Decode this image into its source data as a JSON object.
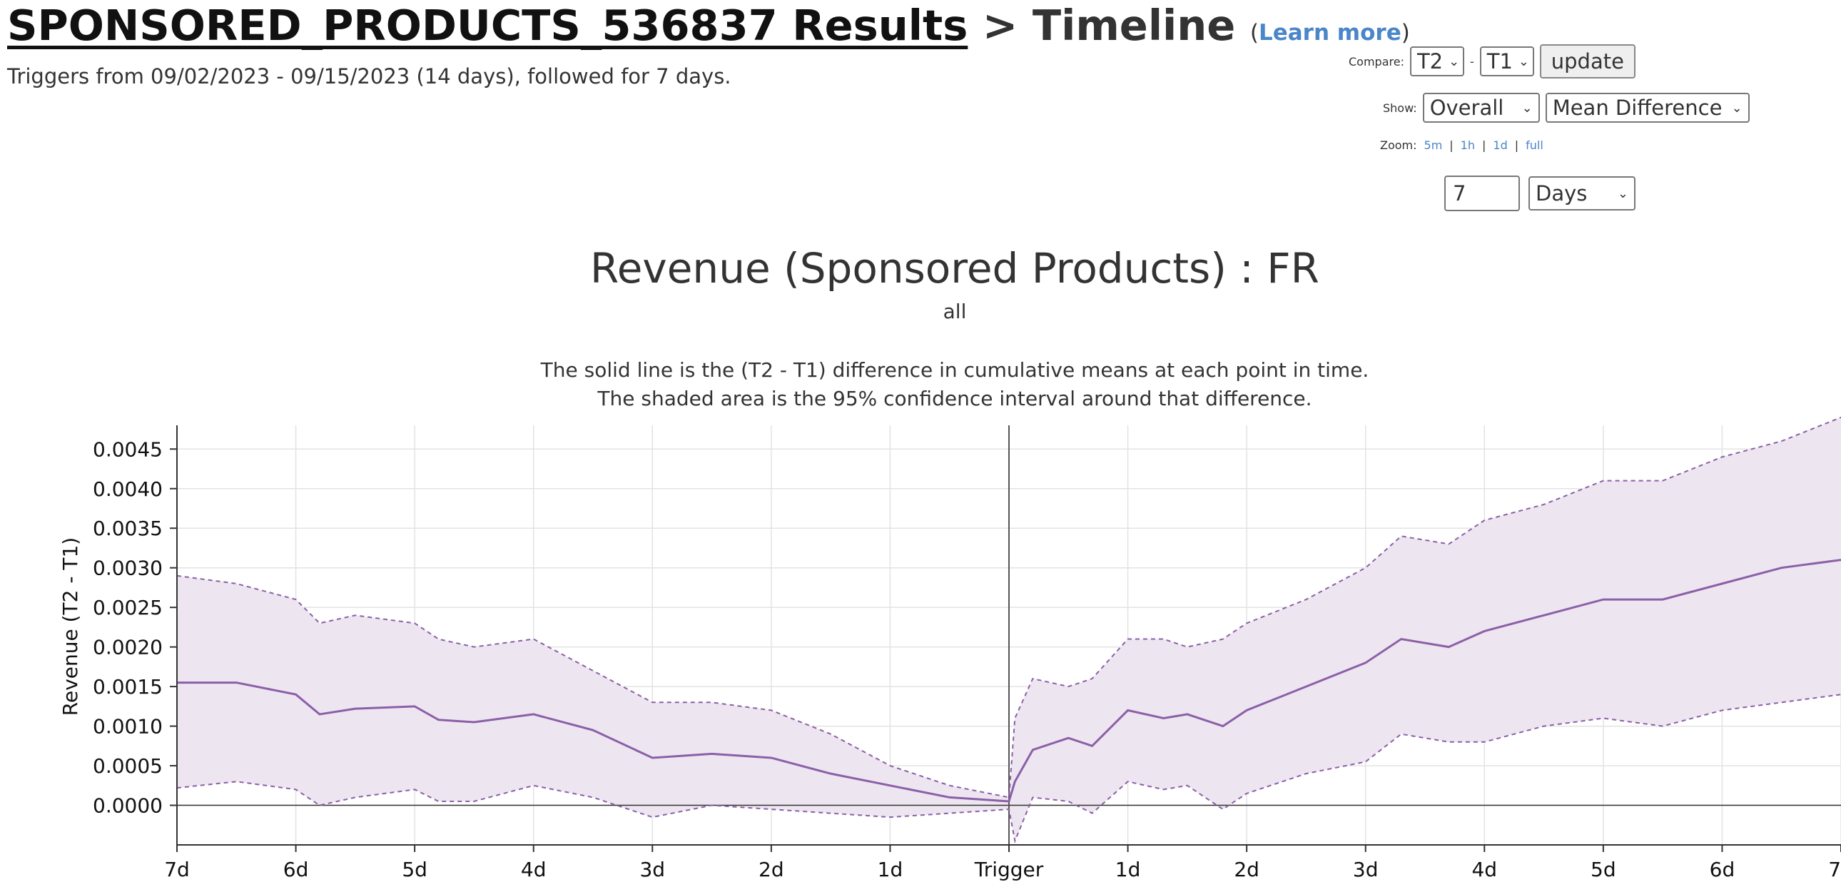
{
  "header": {
    "title_link": "SPONSORED_PRODUCTS_536837 Results",
    "title_sep": " > Timeline",
    "learn_open": "(",
    "learn_link": "Learn more",
    "learn_close": ")",
    "subtitle": "Triggers from 09/02/2023 - 09/15/2023 (14 days), followed for 7 days."
  },
  "controls": {
    "compare_label": "Compare:",
    "compare_a": "T2",
    "compare_dash": "-",
    "compare_b": "T1",
    "update_label": "update",
    "show_label": "Show:",
    "show_scope": "Overall",
    "show_metric": "Mean Difference",
    "zoom_label": "Zoom:",
    "zoom_5m": "5m",
    "zoom_1h": "1h",
    "zoom_1d": "1d",
    "zoom_full": "full",
    "zoom_sep": "|",
    "range_value": "7",
    "range_unit": "Days"
  },
  "colors": {
    "line": "#8c5fa8",
    "band_fill": "#ede6f0",
    "grid": "#e3e3e3",
    "axis": "#333333",
    "link": "#4a86c8"
  },
  "chart_data": {
    "type": "line",
    "title": "Revenue (Sponsored Products) : FR",
    "subtitle": "all",
    "description": [
      "The solid line is the (T2 - T1) difference in cumulative means at each point in time.",
      "The shaded area is the 95% confidence interval around that difference."
    ],
    "xlabel": "",
    "ylabel": "Revenue (T2 - T1)",
    "x_ticks": [
      "7d",
      "6d",
      "5d",
      "4d",
      "3d",
      "2d",
      "1d",
      "Trigger",
      "1d",
      "2d",
      "3d",
      "4d",
      "5d",
      "6d",
      "7d"
    ],
    "x_unit": "days relative to trigger",
    "xlim": [
      -7,
      7
    ],
    "ylim": [
      -0.0005,
      0.0048
    ],
    "y_ticks": [
      0.0,
      0.0005,
      0.001,
      0.0015,
      0.002,
      0.0025,
      0.003,
      0.0035,
      0.004,
      0.0045
    ],
    "grid": true,
    "series": [
      {
        "x": [
          -7,
          -6.5,
          -6,
          -5.8,
          -5.5,
          -5,
          -4.8,
          -4.5,
          -4,
          -3.5,
          -3,
          -2.5,
          -2,
          -1.5,
          -1,
          -0.5,
          0,
          0.05,
          0.2,
          0.5,
          0.7,
          1,
          1.3,
          1.5,
          1.8,
          2,
          2.5,
          3,
          3.3,
          3.7,
          4,
          4.5,
          5,
          5.5,
          6,
          6.5,
          7
        ],
        "mean": [
          0.00155,
          0.00155,
          0.0014,
          0.00115,
          0.00122,
          0.00125,
          0.00108,
          0.00105,
          0.00115,
          0.00095,
          0.0006,
          0.00065,
          0.0006,
          0.0004,
          0.00025,
          0.0001,
          5e-05,
          0.0003,
          0.0007,
          0.00085,
          0.00075,
          0.0012,
          0.0011,
          0.00115,
          0.001,
          0.0012,
          0.0015,
          0.0018,
          0.0021,
          0.002,
          0.0022,
          0.0024,
          0.0026,
          0.0026,
          0.0028,
          0.003,
          0.0031
        ],
        "lower": [
          0.00022,
          0.0003,
          0.0002,
          0.0,
          0.0001,
          0.0002,
          5e-05,
          5e-05,
          0.00025,
          0.0001,
          -0.00015,
          0.0,
          -5e-05,
          -0.0001,
          -0.00015,
          -0.0001,
          -5e-05,
          -0.00045,
          0.0001,
          5e-05,
          -0.0001,
          0.0003,
          0.0002,
          0.00025,
          -5e-05,
          0.00015,
          0.0004,
          0.00055,
          0.0009,
          0.0008,
          0.0008,
          0.001,
          0.0011,
          0.001,
          0.0012,
          0.0013,
          0.0014
        ],
        "upper": [
          0.0029,
          0.0028,
          0.0026,
          0.0023,
          0.0024,
          0.0023,
          0.0021,
          0.002,
          0.0021,
          0.0017,
          0.0013,
          0.0013,
          0.0012,
          0.0009,
          0.0005,
          0.00025,
          0.0001,
          0.0011,
          0.0016,
          0.0015,
          0.0016,
          0.0021,
          0.0021,
          0.002,
          0.0021,
          0.0023,
          0.0026,
          0.003,
          0.0034,
          0.0033,
          0.0036,
          0.0038,
          0.0041,
          0.0041,
          0.0044,
          0.0046,
          0.0049
        ]
      }
    ]
  }
}
